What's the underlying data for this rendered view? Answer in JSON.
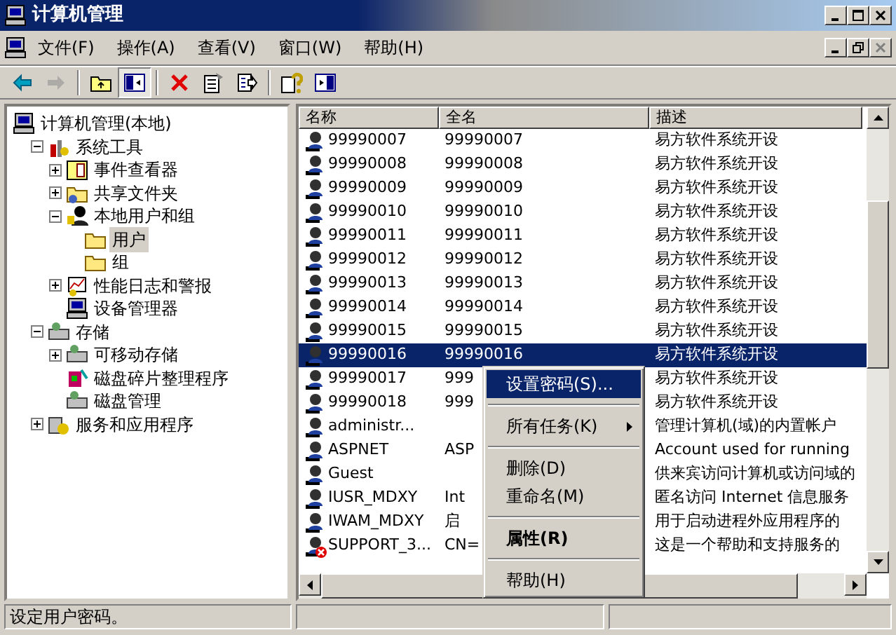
{
  "window": {
    "title": "计算机管理"
  },
  "menu_bar": [
    {
      "label": "文件(F)"
    },
    {
      "label": "操作(A)"
    },
    {
      "label": "查看(V)"
    },
    {
      "label": "窗口(W)"
    },
    {
      "label": "帮助(H)"
    }
  ],
  "toolbar": [
    {
      "kind": "back",
      "disabled": false,
      "pressed": false
    },
    {
      "kind": "forward",
      "disabled": true,
      "pressed": false
    },
    {
      "kind": "separator"
    },
    {
      "kind": "up",
      "disabled": false,
      "pressed": false
    },
    {
      "kind": "tree",
      "disabled": false,
      "pressed": true
    },
    {
      "kind": "separator"
    },
    {
      "kind": "delete",
      "disabled": false,
      "pressed": false
    },
    {
      "kind": "properties",
      "disabled": false,
      "pressed": false
    },
    {
      "kind": "export",
      "disabled": false,
      "pressed": false
    },
    {
      "kind": "separator"
    },
    {
      "kind": "help",
      "disabled": false,
      "pressed": false
    },
    {
      "kind": "pane",
      "disabled": false,
      "pressed": false
    }
  ],
  "tree": [
    {
      "label": "计算机管理(本地)",
      "kind": "computer",
      "selected": false,
      "children": [
        {
          "label": "系统工具",
          "kind": "tools",
          "expanded": true,
          "selected": false,
          "children": [
            {
              "label": "事件查看器",
              "kind": "event",
              "expanded": false,
              "selected": false
            },
            {
              "label": "共享文件夹",
              "kind": "share",
              "expanded": false,
              "selected": false
            },
            {
              "label": "本地用户和组",
              "kind": "users",
              "expanded": true,
              "selected": false,
              "children": [
                {
                  "label": "用户",
                  "kind": "folder",
                  "selected": true
                },
                {
                  "label": "组",
                  "kind": "folder",
                  "selected": false
                }
              ]
            },
            {
              "label": "性能日志和警报",
              "kind": "chart",
              "expanded": false,
              "selected": false
            },
            {
              "label": "设备管理器",
              "kind": "computer",
              "selected": false
            }
          ]
        },
        {
          "label": "存储",
          "kind": "drive",
          "expanded": true,
          "selected": false,
          "children": [
            {
              "label": "可移动存储",
              "kind": "drive",
              "expanded": false,
              "selected": false
            },
            {
              "label": "磁盘碎片整理程序",
              "kind": "defrag",
              "selected": false
            },
            {
              "label": "磁盘管理",
              "kind": "drive",
              "selected": false
            }
          ]
        },
        {
          "label": "服务和应用程序",
          "kind": "service",
          "expanded": false,
          "selected": false
        }
      ]
    }
  ],
  "list": {
    "columns": [
      "名称",
      "全名",
      "描述"
    ],
    "rows": [
      {
        "name": "99990007",
        "full_name": "99990007",
        "description": "易方软件系统开设",
        "selected": false,
        "disabled": false
      },
      {
        "name": "99990008",
        "full_name": "99990008",
        "description": "易方软件系统开设",
        "selected": false,
        "disabled": false
      },
      {
        "name": "99990009",
        "full_name": "99990009",
        "description": "易方软件系统开设",
        "selected": false,
        "disabled": false
      },
      {
        "name": "99990010",
        "full_name": "99990010",
        "description": "易方软件系统开设",
        "selected": false,
        "disabled": false
      },
      {
        "name": "99990011",
        "full_name": "99990011",
        "description": "易方软件系统开设",
        "selected": false,
        "disabled": false
      },
      {
        "name": "99990012",
        "full_name": "99990012",
        "description": "易方软件系统开设",
        "selected": false,
        "disabled": false
      },
      {
        "name": "99990013",
        "full_name": "99990013",
        "description": "易方软件系统开设",
        "selected": false,
        "disabled": false
      },
      {
        "name": "99990014",
        "full_name": "99990014",
        "description": "易方软件系统开设",
        "selected": false,
        "disabled": false
      },
      {
        "name": "99990015",
        "full_name": "99990015",
        "description": "易方软件系统开设",
        "selected": false,
        "disabled": false
      },
      {
        "name": "99990016",
        "full_name": "99990016",
        "description": "易方软件系统开设",
        "selected": true,
        "disabled": false
      },
      {
        "name": "99990017",
        "full_name": "999",
        "description": "易方软件系统开设",
        "selected": false,
        "disabled": false
      },
      {
        "name": "99990018",
        "full_name": "999",
        "description": "易方软件系统开设",
        "selected": false,
        "disabled": false
      },
      {
        "name": "administr...",
        "description": "管理计算机(域)的内置帐户",
        "selected": false,
        "disabled": false
      },
      {
        "name": "ASPNET",
        "full_name": "ASP",
        "description": "Account used for running",
        "selected": false,
        "disabled": false
      },
      {
        "name": "Guest",
        "description": "供来宾访问计算机或访问域的",
        "selected": false,
        "disabled": false
      },
      {
        "name": "IUSR_MDXY",
        "full_name": "Int",
        "description": "匿名访问 Internet 信息服务",
        "selected": false,
        "disabled": false
      },
      {
        "name": "IWAM_MDXY",
        "full_name": "启",
        "description": "用于启动进程外应用程序的",
        "selected": false,
        "disabled": false
      },
      {
        "name": "SUPPORT_3...",
        "full_name": "CN=",
        "description": "这是一个帮助和支持服务的",
        "selected": false,
        "disabled": true
      }
    ]
  },
  "context_menu": [
    {
      "kind": "item",
      "label": "设置密码(S)...",
      "selected": true
    },
    {
      "kind": "separator"
    },
    {
      "kind": "submenu",
      "label": "所有任务(K)",
      "selected": false
    },
    {
      "kind": "separator"
    },
    {
      "kind": "item",
      "label": "删除(D)",
      "selected": false
    },
    {
      "kind": "item",
      "label": "重命名(M)",
      "selected": false
    },
    {
      "kind": "separator"
    },
    {
      "kind": "default",
      "label": "属性(R)",
      "selected": false
    },
    {
      "kind": "separator"
    },
    {
      "kind": "item",
      "label": "帮助(H)",
      "selected": false
    }
  ],
  "status_bar": {
    "text": "设定用户密码。"
  }
}
